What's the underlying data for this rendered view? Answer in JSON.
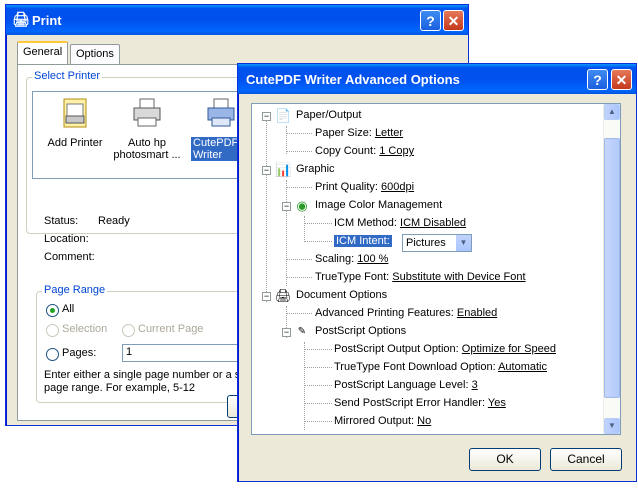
{
  "print_dialog": {
    "title": "Print",
    "tabs": [
      {
        "label": "General",
        "active": true
      },
      {
        "label": "Options",
        "active": false
      }
    ],
    "select_printer_label": "Select Printer",
    "printers": [
      {
        "label": "Add Printer",
        "icon": "add-printer-icon"
      },
      {
        "label": "Auto hp photosmart ...",
        "icon": "printer-icon"
      },
      {
        "label": "CutePDF Writer",
        "icon": "printer-icon",
        "selected": true
      }
    ],
    "status": {
      "label": "Status:",
      "value": "Ready"
    },
    "location": {
      "label": "Location:",
      "value": ""
    },
    "comment": {
      "label": "Comment:",
      "value": ""
    },
    "page_range": {
      "label": "Page Range",
      "all_label": "All",
      "selection_label": "Selection",
      "current_page_label": "Current Page",
      "pages_label": "Pages:",
      "pages_value": "1",
      "hint_line1": "Enter either a single page number or a sing",
      "hint_line2": "page range.  For example, 5-12"
    }
  },
  "advanced_dialog": {
    "title": "CutePDF Writer Advanced Options",
    "tree": {
      "paper_output": "Paper/Output",
      "paper_size_label": "Paper Size:",
      "paper_size_value": "Letter",
      "copy_count_label": "Copy Count:",
      "copy_count_value": "1 Copy",
      "graphic": "Graphic",
      "print_quality_label": "Print Quality:",
      "print_quality_value": "600dpi",
      "icm": "Image Color Management",
      "icm_method_label": "ICM Method:",
      "icm_method_value": "ICM Disabled",
      "icm_intent_label": "ICM Intent:",
      "icm_intent_value": "Pictures",
      "scaling_label": "Scaling:",
      "scaling_value": "100 %",
      "truetype_label": "TrueType Font:",
      "truetype_value": "Substitute with Device Font",
      "document_options": "Document Options",
      "adv_print_label": "Advanced Printing Features:",
      "adv_print_value": "Enabled",
      "postscript_options": "PostScript Options",
      "ps_output_label": "PostScript Output Option:",
      "ps_output_value": "Optimize for Speed",
      "tt_download_label": "TrueType Font Download Option:",
      "tt_download_value": "Automatic",
      "ps_level_label": "PostScript Language Level:",
      "ps_level_value": "3",
      "ps_error_label": "Send PostScript Error Handler:",
      "ps_error_value": "Yes",
      "mirrored_label": "Mirrored Output:",
      "mirrored_value": "No"
    },
    "ok_label": "OK",
    "cancel_label": "Cancel"
  },
  "colors": {
    "title_blue": "#0054e3",
    "group_label": "#0046d5",
    "selection": "#316ac5",
    "dialog_bg": "#ece9d8"
  }
}
